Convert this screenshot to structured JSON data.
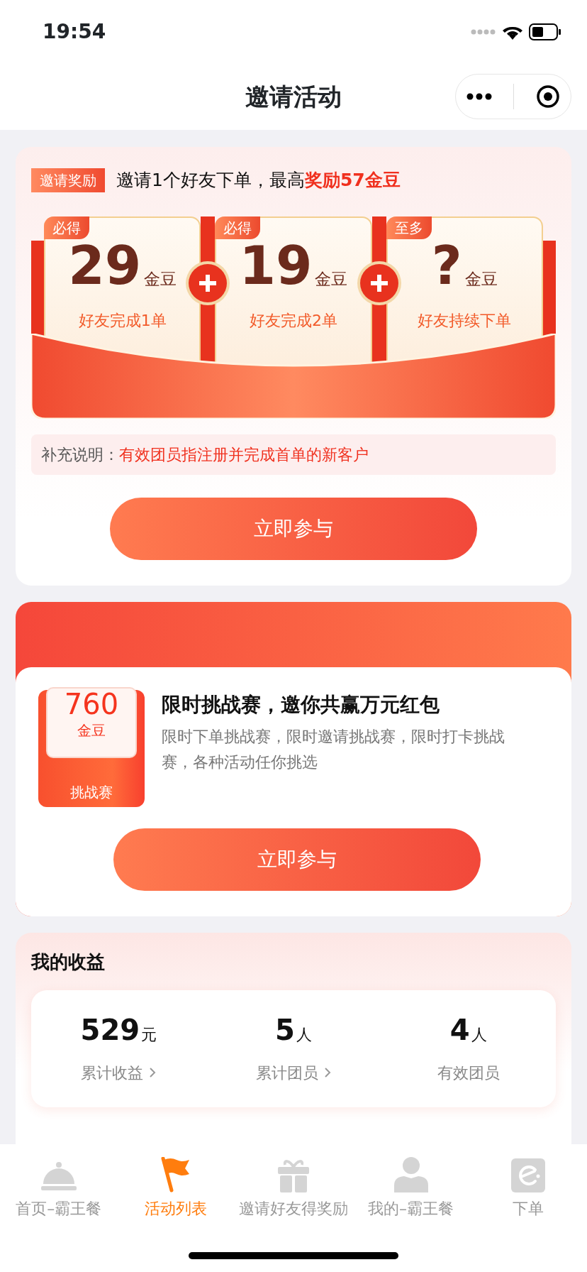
{
  "status_bar": {
    "time": "19:54"
  },
  "nav": {
    "title": "邀请活动"
  },
  "invite": {
    "tag": "邀请奖励",
    "headline": "邀请1个好友下单，最高**奖励57金豆**",
    "rewards": [
      {
        "badge": "必得",
        "amount": "29",
        "unit": "金豆",
        "caption": "好友完成1单"
      },
      {
        "badge": "必得",
        "amount": "19",
        "unit": "金豆",
        "caption": "好友完成2单"
      },
      {
        "badge": "至多",
        "amount": "?",
        "unit": "金豆",
        "caption": "好友持续下单"
      }
    ],
    "note_label": "补充说明：",
    "note_text": "有效团员指注册并完成首单的新客户",
    "button": "立即参与"
  },
  "challenge": {
    "amount": "760",
    "unit": "金豆",
    "ribbon": "挑战赛",
    "title": "限时挑战赛，邀你共赢万元红包",
    "description": "限时下单挑战赛，限时邀请挑战赛，限时打卡挑战赛，各种活动任你挑选",
    "button": "立即参与"
  },
  "earnings": {
    "title": "我的收益",
    "stats": [
      {
        "value": "529",
        "unit": "元",
        "label": "累计收益",
        "has_arrow": true
      },
      {
        "value": "5",
        "unit": "人",
        "label": "累计团员",
        "has_arrow": true
      },
      {
        "value": "4",
        "unit": "人",
        "label": "有效团员",
        "has_arrow": false
      }
    ]
  },
  "tab_bar": [
    {
      "kind": "cloche",
      "label": "首页–霸王餐",
      "selected": false
    },
    {
      "kind": "flag",
      "label": "活动列表",
      "selected": true
    },
    {
      "kind": "gift",
      "label": "邀请好友得奖励",
      "selected": false
    },
    {
      "kind": "person",
      "label": "我的–霸王餐",
      "selected": false
    },
    {
      "kind": "logo",
      "label": "下单",
      "selected": false
    }
  ]
}
